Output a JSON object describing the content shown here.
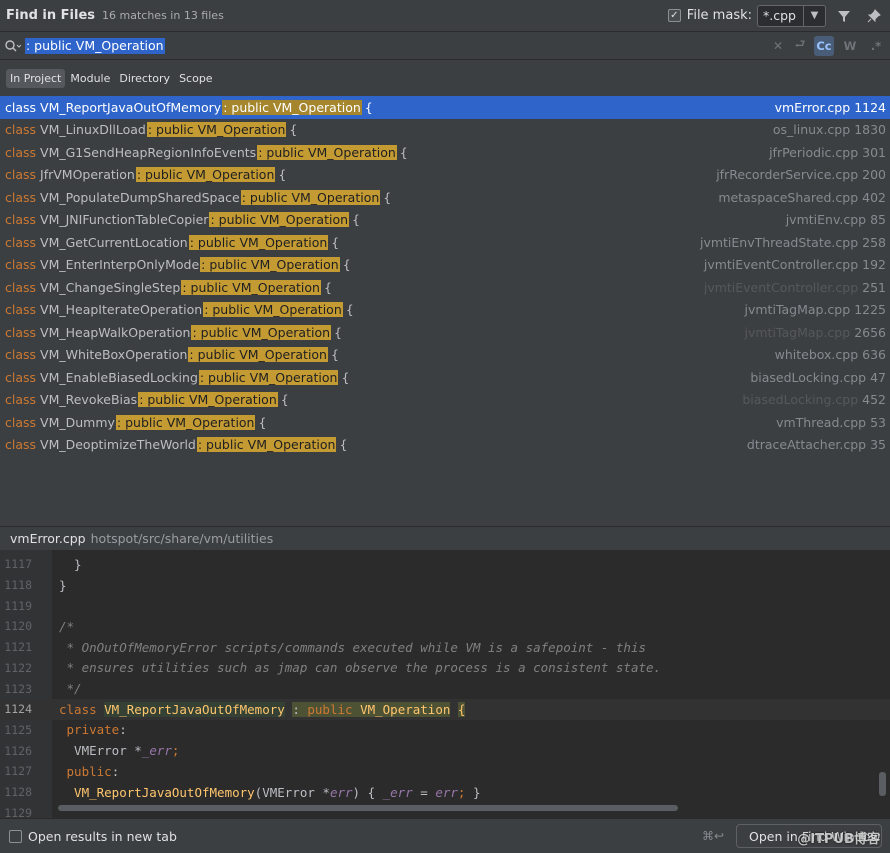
{
  "header": {
    "title": "Find in Files",
    "matches": "16 matches in 13 files",
    "file_mask_label": "File mask:",
    "file_mask_value": "*.cpp"
  },
  "search": {
    "query": ": public VM_Operation",
    "toggles": [
      "Cc",
      "W",
      ".*"
    ]
  },
  "scope": {
    "tabs": [
      "In Project",
      "Module",
      "Directory",
      "Scope"
    ],
    "active": "In Project"
  },
  "results": [
    {
      "kw": "class",
      "name": "VM_ReportJavaOutOfMemory",
      "match": ": public VM_Operation",
      "brace": "{",
      "file": "vmError.cpp",
      "line": "1124",
      "selected": true
    },
    {
      "kw": "class",
      "name": "VM_LinuxDllLoad",
      "match": ": public VM_Operation",
      "brace": "{",
      "file": "os_linux.cpp",
      "line": "1830"
    },
    {
      "kw": "class",
      "name": "VM_G1SendHeapRegionInfoEvents",
      "match": ": public VM_Operation",
      "brace": "{",
      "file": "jfrPeriodic.cpp",
      "line": "301"
    },
    {
      "kw": "class",
      "name": "JfrVMOperation",
      "match": ": public VM_Operation",
      "brace": "{",
      "file": "jfrRecorderService.cpp",
      "line": "200"
    },
    {
      "kw": "class",
      "name": "VM_PopulateDumpSharedSpace",
      "match": ": public VM_Operation",
      "brace": "{",
      "file": "metaspaceShared.cpp",
      "line": "402"
    },
    {
      "kw": "class",
      "name": "VM_JNIFunctionTableCopier",
      "match": ": public VM_Operation",
      "brace": "{",
      "file": "jvmtiEnv.cpp",
      "line": "85"
    },
    {
      "kw": "class",
      "name": "VM_GetCurrentLocation",
      "match": ": public VM_Operation",
      "brace": "{",
      "file": "jvmtiEnvThreadState.cpp",
      "line": "258"
    },
    {
      "kw": "class",
      "name": "VM_EnterInterpOnlyMode",
      "match": ": public VM_Operation",
      "brace": "{",
      "file": "jvmtiEventController.cpp",
      "line": "192"
    },
    {
      "kw": "class",
      "name": "VM_ChangeSingleStep",
      "match": ": public VM_Operation",
      "brace": "{",
      "file": "jvmtiEventController.cpp",
      "line": "251",
      "dim": true
    },
    {
      "kw": "class",
      "name": "VM_HeapIterateOperation",
      "match": ": public VM_Operation",
      "brace": "{",
      "file": "jvmtiTagMap.cpp",
      "line": "1225"
    },
    {
      "kw": "class",
      "name": "VM_HeapWalkOperation",
      "match": ": public VM_Operation",
      "brace": "{",
      "file": "jvmtiTagMap.cpp",
      "line": "2656",
      "dim": true
    },
    {
      "kw": "class",
      "name": "VM_WhiteBoxOperation",
      "match": ": public VM_Operation",
      "brace": "{",
      "file": "whitebox.cpp",
      "line": "636"
    },
    {
      "kw": "class",
      "name": "VM_EnableBiasedLocking",
      "match": ": public VM_Operation",
      "brace": "{",
      "file": "biasedLocking.cpp",
      "line": "47"
    },
    {
      "kw": "class",
      "name": "VM_RevokeBias",
      "match": ": public VM_Operation",
      "brace": "{",
      "file": "biasedLocking.cpp",
      "line": "452",
      "dim": true
    },
    {
      "kw": "class",
      "name": "VM_Dummy",
      "match": ": public VM_Operation",
      "brace": "{",
      "file": "vmThread.cpp",
      "line": "53"
    },
    {
      "kw": "class",
      "name": "VM_DeoptimizeTheWorld",
      "match": ": public VM_Operation",
      "brace": "{",
      "file": "dtraceAttacher.cpp",
      "line": "35"
    }
  ],
  "preview": {
    "file": "vmError.cpp",
    "path": "hotspot/src/share/vm/utilities",
    "lines": [
      {
        "n": "1117",
        "segs": [
          {
            "t": "  }",
            "c": "c-def"
          }
        ]
      },
      {
        "n": "1118",
        "segs": [
          {
            "t": "}",
            "c": "c-def"
          }
        ]
      },
      {
        "n": "1119",
        "segs": []
      },
      {
        "n": "1120",
        "segs": [
          {
            "t": "/*",
            "c": "c-com"
          }
        ]
      },
      {
        "n": "1121",
        "segs": [
          {
            "t": " * OnOutOfMemoryError scripts/commands executed while VM is a safepoint - this",
            "c": "c-com"
          }
        ]
      },
      {
        "n": "1122",
        "segs": [
          {
            "t": " * ensures utilities such as jmap can observe the process is a consistent state.",
            "c": "c-com"
          }
        ]
      },
      {
        "n": "1123",
        "segs": [
          {
            "t": " */",
            "c": "c-com"
          }
        ]
      },
      {
        "n": "1124",
        "current": true,
        "segs": [
          {
            "t": "class ",
            "c": "c-kw"
          },
          {
            "t": "VM_ReportJavaOutOfMemory",
            "c": "c-cls c-ref"
          },
          {
            "t": " ",
            "c": "c-def"
          },
          {
            "t": ": ",
            "c": "c-def c-mark"
          },
          {
            "t": "public ",
            "c": "c-kw c-mark"
          },
          {
            "t": "VM_Operation",
            "c": "c-cls c-mark"
          },
          {
            "t": " ",
            "c": "c-def"
          },
          {
            "t": "{",
            "c": "c-sym c-mark"
          }
        ]
      },
      {
        "n": "1125",
        "segs": [
          {
            "t": " private",
            "c": "c-kw"
          },
          {
            "t": ":",
            "c": "c-def"
          }
        ]
      },
      {
        "n": "1126",
        "segs": [
          {
            "t": "  VMError ",
            "c": "c-def"
          },
          {
            "t": "*",
            "c": "c-def"
          },
          {
            "t": "_err",
            "c": "c-var"
          },
          {
            "t": ";",
            "c": "c-kw"
          }
        ]
      },
      {
        "n": "1127",
        "segs": [
          {
            "t": " public",
            "c": "c-kw"
          },
          {
            "t": ":",
            "c": "c-def"
          }
        ]
      },
      {
        "n": "1128",
        "segs": [
          {
            "t": "  VM_ReportJavaOutOfMemory",
            "c": "c-sym"
          },
          {
            "t": "(VMError *",
            "c": "c-def"
          },
          {
            "t": "err",
            "c": "c-var"
          },
          {
            "t": ") { ",
            "c": "c-def"
          },
          {
            "t": "_err",
            "c": "c-var"
          },
          {
            "t": " = ",
            "c": "c-def"
          },
          {
            "t": "err",
            "c": "c-var"
          },
          {
            "t": "; ",
            "c": "c-kw"
          },
          {
            "t": "}",
            "c": "c-def"
          }
        ]
      },
      {
        "n": "1129",
        "segs": []
      }
    ]
  },
  "footer": {
    "open_new_tab_label": "Open results in new tab",
    "shortcut": "⌘↩",
    "open_button_label": "Open in Find Window"
  },
  "watermark": "@ITPUB博客"
}
